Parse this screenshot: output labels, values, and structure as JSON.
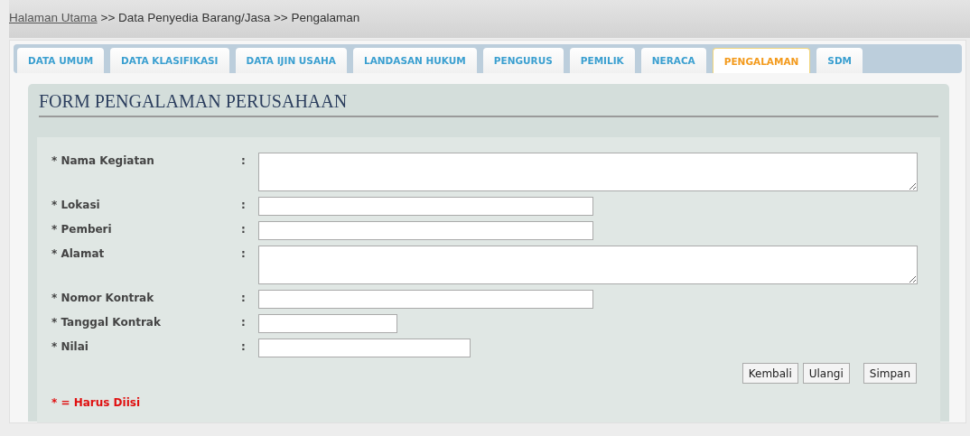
{
  "breadcrumb": {
    "link": "Halaman Utama",
    "trail": ">> Data Penyedia Barang/Jasa >> Pengalaman"
  },
  "tabs": [
    {
      "label": "DATA UMUM",
      "selected": false
    },
    {
      "label": "DATA KLASIFIKASI",
      "selected": false
    },
    {
      "label": "DATA IJIN USAHA",
      "selected": false
    },
    {
      "label": "LANDASAN HUKUM",
      "selected": false
    },
    {
      "label": "PENGURUS",
      "selected": false
    },
    {
      "label": "PEMILIK",
      "selected": false
    },
    {
      "label": "NERACA",
      "selected": false
    },
    {
      "label": "PENGALAMAN",
      "selected": true
    },
    {
      "label": "SDM",
      "selected": false
    }
  ],
  "form": {
    "title": "FORM PENGALAMAN PERUSAHAAN",
    "fields": [
      {
        "label": "* Nama Kegiatan",
        "separator": ":",
        "kind": "textarea"
      },
      {
        "label": "* Lokasi",
        "separator": ":",
        "kind": "long"
      },
      {
        "label": "* Pemberi",
        "separator": ":",
        "kind": "long"
      },
      {
        "label": "* Alamat",
        "separator": ":",
        "kind": "textarea"
      },
      {
        "label": "* Nomor Kontrak",
        "separator": ":",
        "kind": "long"
      },
      {
        "label": "* Tanggal Kontrak",
        "separator": ":",
        "kind": "date"
      },
      {
        "label": "* Nilai",
        "separator": ":",
        "kind": "medium"
      }
    ],
    "buttons": [
      "Kembali",
      "Ulangi",
      "Simpan"
    ],
    "required_note": "* = Harus Diisi"
  }
}
